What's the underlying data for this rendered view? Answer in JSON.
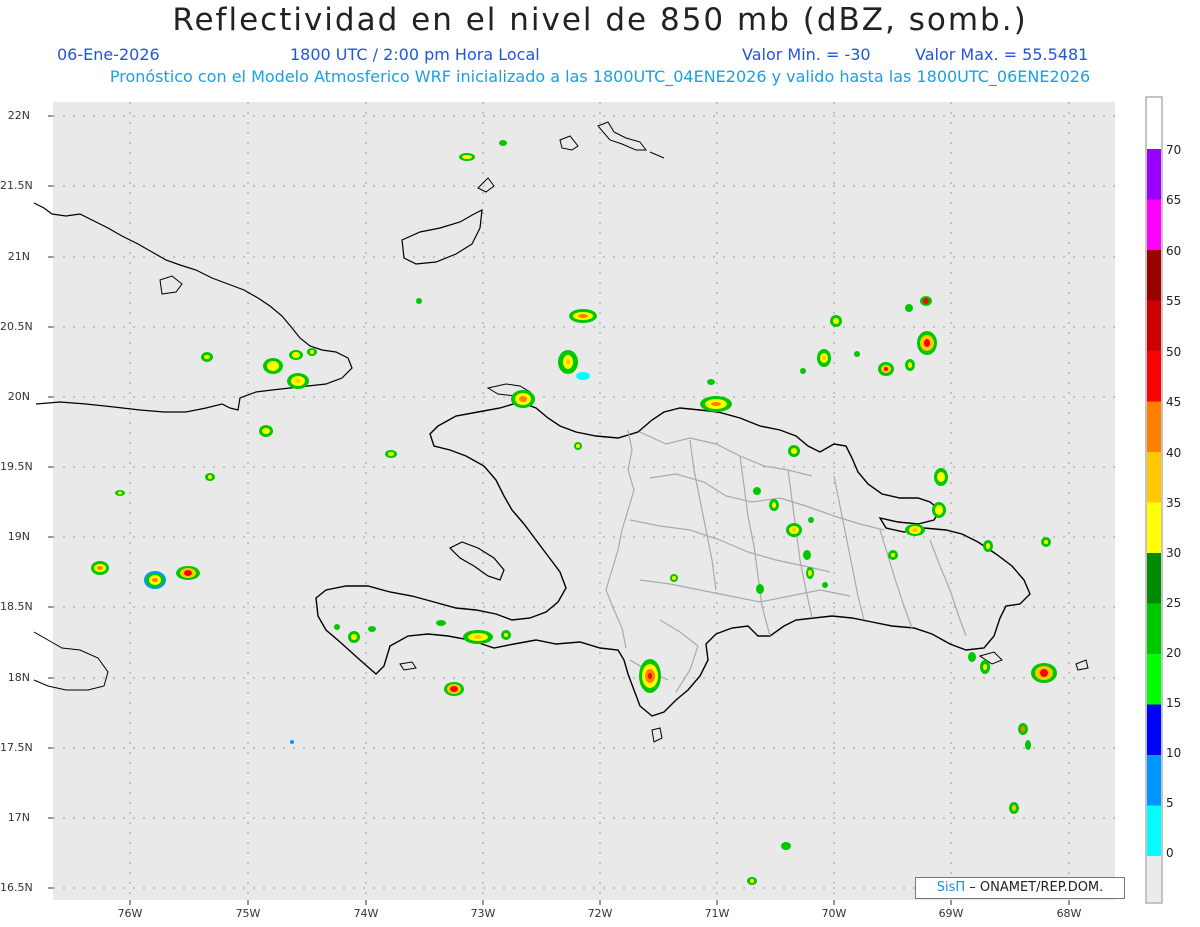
{
  "title": "Reflectividad en el nivel de 850 mb (dBZ, somb.)",
  "header": {
    "date": "06-Ene-2026",
    "time": "1800 UTC / 2:00 pm Hora Local",
    "value_min": "Valor Min. = -30",
    "value_max": "Valor Max. = 55.5481",
    "subtitle": "Pronóstico con el Modelo Atmosferico WRF inicializado a las 1800UTC_04ENE2026 y valido hasta las  1800UTC_06ENE2026"
  },
  "axes": {
    "lat_labels": [
      "22N",
      "21.5N",
      "21N",
      "20.5N",
      "20N",
      "19.5N",
      "19N",
      "18.5N",
      "18N",
      "17.5N",
      "17N",
      "16.5N"
    ],
    "lon_labels": [
      "76W",
      "75W",
      "74W",
      "73W",
      "72W",
      "71W",
      "70W",
      "69W",
      "68W"
    ]
  },
  "colorbar": {
    "labels": [
      "70",
      "65",
      "60",
      "55",
      "50",
      "45",
      "40",
      "35",
      "30",
      "25",
      "20",
      "15",
      "10",
      "5",
      "0"
    ],
    "colors": [
      "#9900ff",
      "#ff00ff",
      "#990000",
      "#cc0000",
      "#ff0000",
      "#ff7f00",
      "#ffc800",
      "#ffff00",
      "#008c00",
      "#00c800",
      "#00ff00",
      "#0000ff",
      "#0096ff",
      "#00ffff",
      "#ebebeb"
    ]
  },
  "credit": {
    "brand": "SisΠ",
    "text": "– ONAMET/REP.DOM."
  },
  "colors": {
    "map_background": "#e9e9e9",
    "coastline": "#000000",
    "province_border": "#aaaaaa",
    "grid": "#9a9a9a"
  }
}
